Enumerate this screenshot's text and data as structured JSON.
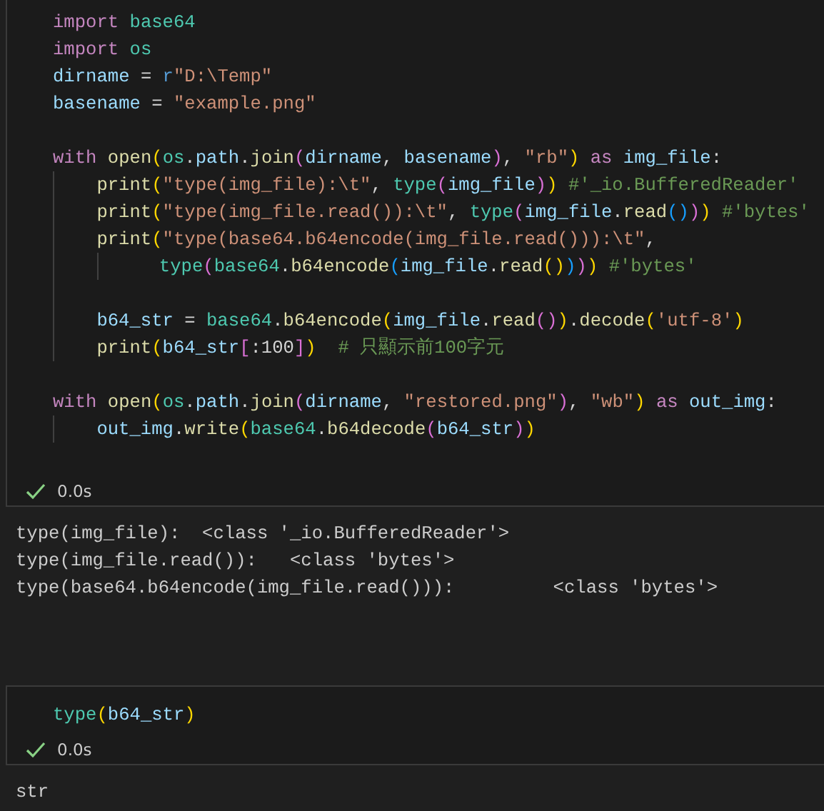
{
  "cells": [
    {
      "lines": [
        {
          "kind": "code",
          "tokens": [
            {
              "kind": "kw",
              "text": "import "
            },
            {
              "kind": "mod",
              "text": "base64"
            }
          ]
        },
        {
          "kind": "code",
          "tokens": [
            {
              "kind": "kw",
              "text": "import "
            },
            {
              "kind": "mod",
              "text": "os"
            }
          ]
        },
        {
          "kind": "code",
          "tokens": [
            {
              "kind": "var",
              "text": "dirname "
            },
            {
              "kind": "op",
              "text": "= "
            },
            {
              "kind": "pre",
              "text": "r"
            },
            {
              "kind": "str",
              "text": "\"D:\\Temp\""
            }
          ]
        },
        {
          "kind": "code",
          "tokens": [
            {
              "kind": "var",
              "text": "basename "
            },
            {
              "kind": "op",
              "text": "= "
            },
            {
              "kind": "str",
              "text": "\"example.png\""
            }
          ]
        },
        {
          "kind": "blank"
        },
        {
          "kind": "code",
          "tokens": [
            {
              "kind": "kw",
              "text": "with "
            },
            {
              "kind": "fn",
              "text": "open"
            },
            {
              "kind": "b1",
              "text": "("
            },
            {
              "kind": "mod",
              "text": "os"
            },
            {
              "kind": "op",
              "text": "."
            },
            {
              "kind": "var",
              "text": "path"
            },
            {
              "kind": "op",
              "text": "."
            },
            {
              "kind": "fn",
              "text": "join"
            },
            {
              "kind": "b2",
              "text": "("
            },
            {
              "kind": "var",
              "text": "dirname"
            },
            {
              "kind": "op",
              "text": ", "
            },
            {
              "kind": "var",
              "text": "basename"
            },
            {
              "kind": "b2",
              "text": ")"
            },
            {
              "kind": "op",
              "text": ", "
            },
            {
              "kind": "str",
              "text": "\"rb\""
            },
            {
              "kind": "b1",
              "text": ") "
            },
            {
              "kind": "kw",
              "text": "as "
            },
            {
              "kind": "var",
              "text": "img_file"
            },
            {
              "kind": "op",
              "text": ":"
            }
          ],
          "children": [
            {
              "kind": "code",
              "tokens": [
                {
                  "kind": "fn",
                  "text": "print"
                },
                {
                  "kind": "b1",
                  "text": "("
                },
                {
                  "kind": "str",
                  "text": "\"type(img_file):\\t\""
                },
                {
                  "kind": "op",
                  "text": ", "
                },
                {
                  "kind": "mod",
                  "text": "type"
                },
                {
                  "kind": "b2",
                  "text": "("
                },
                {
                  "kind": "var",
                  "text": "img_file"
                },
                {
                  "kind": "b2",
                  "text": ")"
                },
                {
                  "kind": "b1",
                  "text": ") "
                },
                {
                  "kind": "cmt",
                  "text": "#'_io.BufferedReader'"
                }
              ]
            },
            {
              "kind": "code",
              "tokens": [
                {
                  "kind": "fn",
                  "text": "print"
                },
                {
                  "kind": "b1",
                  "text": "("
                },
                {
                  "kind": "str",
                  "text": "\"type(img_file.read()):\\t\""
                },
                {
                  "kind": "op",
                  "text": ", "
                },
                {
                  "kind": "mod",
                  "text": "type"
                },
                {
                  "kind": "b2",
                  "text": "("
                },
                {
                  "kind": "var",
                  "text": "img_file"
                },
                {
                  "kind": "op",
                  "text": "."
                },
                {
                  "kind": "fn",
                  "text": "read"
                },
                {
                  "kind": "b3",
                  "text": "()"
                },
                {
                  "kind": "b2",
                  "text": ")"
                },
                {
                  "kind": "b1",
                  "text": ") "
                },
                {
                  "kind": "cmt",
                  "text": "#'bytes'"
                }
              ]
            },
            {
              "kind": "code",
              "tokens": [
                {
                  "kind": "fn",
                  "text": "print"
                },
                {
                  "kind": "b1",
                  "text": "("
                },
                {
                  "kind": "str",
                  "text": "\"type(base64.b64encode(img_file.read())):\\t\""
                },
                {
                  "kind": "op",
                  "text": ","
                }
              ],
              "children": [
                {
                  "kind": "continuation",
                  "tokens": [
                    {
                      "kind": "mod",
                      "text": "type"
                    },
                    {
                      "kind": "b2",
                      "text": "("
                    },
                    {
                      "kind": "mod",
                      "text": "base64"
                    },
                    {
                      "kind": "op",
                      "text": "."
                    },
                    {
                      "kind": "fn",
                      "text": "b64encode"
                    },
                    {
                      "kind": "b3",
                      "text": "("
                    },
                    {
                      "kind": "var",
                      "text": "img_file"
                    },
                    {
                      "kind": "op",
                      "text": "."
                    },
                    {
                      "kind": "fn",
                      "text": "read"
                    },
                    {
                      "kind": "b1",
                      "text": "()"
                    },
                    {
                      "kind": "b3",
                      "text": ")"
                    },
                    {
                      "kind": "b2",
                      "text": ")"
                    },
                    {
                      "kind": "b1",
                      "text": ") "
                    },
                    {
                      "kind": "cmt",
                      "text": "#'bytes'"
                    }
                  ]
                }
              ]
            },
            {
              "kind": "blank"
            },
            {
              "kind": "code",
              "tokens": [
                {
                  "kind": "var",
                  "text": "b64_str "
                },
                {
                  "kind": "op",
                  "text": "= "
                },
                {
                  "kind": "mod",
                  "text": "base64"
                },
                {
                  "kind": "op",
                  "text": "."
                },
                {
                  "kind": "fn",
                  "text": "b64encode"
                },
                {
                  "kind": "b1",
                  "text": "("
                },
                {
                  "kind": "var",
                  "text": "img_file"
                },
                {
                  "kind": "op",
                  "text": "."
                },
                {
                  "kind": "fn",
                  "text": "read"
                },
                {
                  "kind": "b2",
                  "text": "()"
                },
                {
                  "kind": "b1",
                  "text": ")"
                },
                {
                  "kind": "op",
                  "text": "."
                },
                {
                  "kind": "fn",
                  "text": "decode"
                },
                {
                  "kind": "b1",
                  "text": "("
                },
                {
                  "kind": "str",
                  "text": "'utf-8'"
                },
                {
                  "kind": "b1",
                  "text": ")"
                }
              ]
            },
            {
              "kind": "code",
              "tokens": [
                {
                  "kind": "fn",
                  "text": "print"
                },
                {
                  "kind": "b1",
                  "text": "("
                },
                {
                  "kind": "var",
                  "text": "b64_str"
                },
                {
                  "kind": "b2",
                  "text": "["
                },
                {
                  "kind": "op",
                  "text": ":100"
                },
                {
                  "kind": "b2",
                  "text": "]"
                },
                {
                  "kind": "b1",
                  "text": ")  "
                },
                {
                  "kind": "cmt",
                  "text": "# 只顯示前100字元"
                }
              ]
            }
          ]
        },
        {
          "kind": "blank"
        },
        {
          "kind": "code",
          "tokens": [
            {
              "kind": "kw",
              "text": "with "
            },
            {
              "kind": "fn",
              "text": "open"
            },
            {
              "kind": "b1",
              "text": "("
            },
            {
              "kind": "mod",
              "text": "os"
            },
            {
              "kind": "op",
              "text": "."
            },
            {
              "kind": "var",
              "text": "path"
            },
            {
              "kind": "op",
              "text": "."
            },
            {
              "kind": "fn",
              "text": "join"
            },
            {
              "kind": "b2",
              "text": "("
            },
            {
              "kind": "var",
              "text": "dirname"
            },
            {
              "kind": "op",
              "text": ", "
            },
            {
              "kind": "str",
              "text": "\"restored.png\""
            },
            {
              "kind": "b2",
              "text": ")"
            },
            {
              "kind": "op",
              "text": ", "
            },
            {
              "kind": "str",
              "text": "\"wb\""
            },
            {
              "kind": "b1",
              "text": ") "
            },
            {
              "kind": "kw",
              "text": "as "
            },
            {
              "kind": "var",
              "text": "out_img"
            },
            {
              "kind": "op",
              "text": ":"
            }
          ],
          "children": [
            {
              "kind": "code",
              "tokens": [
                {
                  "kind": "var",
                  "text": "out_img"
                },
                {
                  "kind": "op",
                  "text": "."
                },
                {
                  "kind": "fn",
                  "text": "write"
                },
                {
                  "kind": "b1",
                  "text": "("
                },
                {
                  "kind": "mod",
                  "text": "base64"
                },
                {
                  "kind": "op",
                  "text": "."
                },
                {
                  "kind": "fn",
                  "text": "b64decode"
                },
                {
                  "kind": "b2",
                  "text": "("
                },
                {
                  "kind": "var",
                  "text": "b64_str"
                },
                {
                  "kind": "b2",
                  "text": ")"
                },
                {
                  "kind": "b1",
                  "text": ")"
                }
              ]
            }
          ]
        }
      ],
      "status": {
        "success": true,
        "duration": "0.0s"
      },
      "output": [
        "type(img_file):\t <class '_io.BufferedReader'>",
        "type(img_file.read()):\t <class 'bytes'>",
        "type(base64.b64encode(img_file.read())):\t <class 'bytes'>"
      ]
    },
    {
      "lines": [
        {
          "kind": "code",
          "tokens": [
            {
              "kind": "mod",
              "text": "type"
            },
            {
              "kind": "b1",
              "text": "("
            },
            {
              "kind": "var",
              "text": "b64_str"
            },
            {
              "kind": "b1",
              "text": ")"
            }
          ]
        }
      ],
      "status": {
        "success": true,
        "duration": "0.0s"
      },
      "output": [
        "str"
      ]
    }
  ]
}
